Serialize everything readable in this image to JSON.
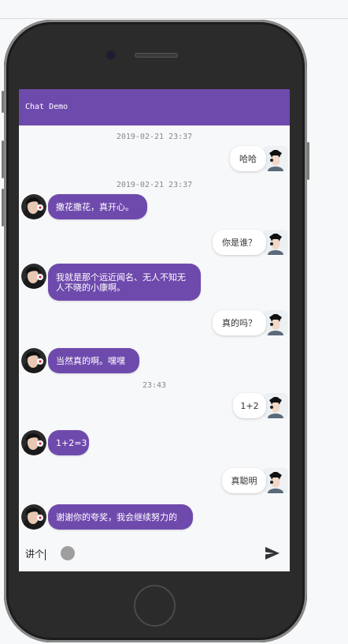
{
  "app": {
    "title": "Chat Demo"
  },
  "messages": [
    {
      "id": 1,
      "type": "timestamp",
      "text": "2019-02-21 23:37"
    },
    {
      "id": 2,
      "type": "sent",
      "text": "哈哈"
    },
    {
      "id": 3,
      "type": "timestamp",
      "text": "2019-02-21 23:37"
    },
    {
      "id": 4,
      "type": "received",
      "text": "撒花撒花，真开心。"
    },
    {
      "id": 5,
      "type": "sent",
      "text": "你是谁？"
    },
    {
      "id": 6,
      "type": "received",
      "text": "我就是那个远近闻名、无人不知无人不晓的小康啊。"
    },
    {
      "id": 7,
      "type": "sent",
      "text": "真的吗？"
    },
    {
      "id": 8,
      "type": "received",
      "text": "当然真的啊。嘿嘿"
    },
    {
      "id": 9,
      "type": "timestamp",
      "text": "23:43"
    },
    {
      "id": 10,
      "type": "sent",
      "text": "1+2"
    },
    {
      "id": 11,
      "type": "received",
      "text": "1+2=3"
    },
    {
      "id": 12,
      "type": "sent",
      "text": "真聪明"
    },
    {
      "id": 13,
      "type": "received",
      "text": "谢谢你的夸奖，我会继续努力的"
    }
  ],
  "input_bar": {
    "input_value": "讲个",
    "send_icon": "send-icon",
    "record_icon": "record-dot-icon"
  },
  "colors": {
    "accent": "#6f4aad",
    "bubble_sent": "#ffffff",
    "background": "#f7f8fa"
  }
}
